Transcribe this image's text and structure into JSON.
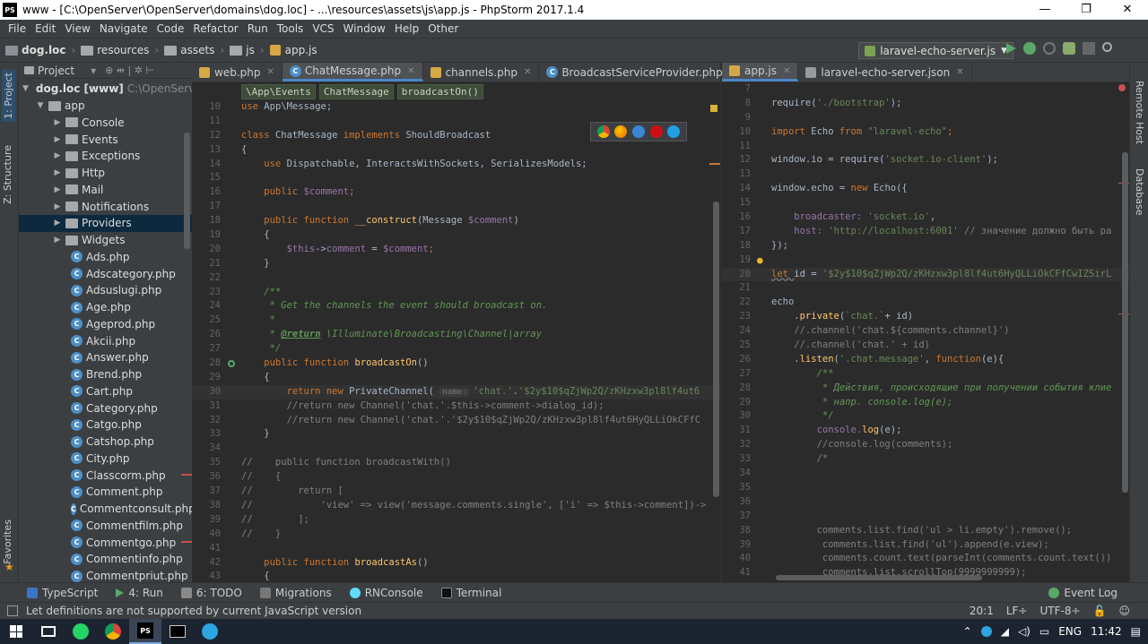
{
  "window": {
    "title": "www - [C:\\OpenServer\\OpenServer\\domains\\dog.loc] - ...\\resources\\assets\\js\\app.js - PhpStorm 2017.1.4",
    "logo_text": "PS",
    "minimize": "—",
    "maximize": "❐",
    "close": "✕"
  },
  "menu": [
    "File",
    "Edit",
    "View",
    "Navigate",
    "Code",
    "Refactor",
    "Run",
    "Tools",
    "VCS",
    "Window",
    "Help",
    "Other"
  ],
  "breadcrumbs": [
    "dog.loc",
    "resources",
    "assets",
    "js",
    "app.js"
  ],
  "run_config": {
    "label": "laravel-echo-server.js",
    "arrow": "▼"
  },
  "side_tabs": {
    "project": "1: Project",
    "structure": "Z: Structure",
    "favorites": "Favorites",
    "remote": "Remote Host",
    "database": "Database"
  },
  "project_panel": {
    "title": "Project",
    "dropdown": "▾",
    "tools": "⊕  ⇹  |  ✲  ⊢",
    "root": {
      "name": "dog.loc [www]",
      "path": "C:\\OpenServer"
    },
    "app": "app",
    "folders": [
      "Console",
      "Events",
      "Exceptions",
      "Http",
      "Mail",
      "Notifications",
      "Providers",
      "Widgets"
    ],
    "selected_folder": "Providers",
    "files": [
      "Ads.php",
      "Adscategory.php",
      "Adsuslugi.php",
      "Age.php",
      "Ageprod.php",
      "Akcii.php",
      "Answer.php",
      "Brend.php",
      "Cart.php",
      "Category.php",
      "Catgo.php",
      "Catshop.php",
      "City.php",
      "Classcorm.php",
      "Comment.php",
      "Commentconsult.php",
      "Commentfilm.php",
      "Commentgo.php",
      "Commentinfo.php",
      "Commentpriut.php"
    ]
  },
  "left_editor": {
    "tabs": [
      {
        "label": "web.php",
        "active": false
      },
      {
        "label": "ChatMessage.php",
        "active": true
      },
      {
        "label": "channels.php",
        "active": false
      },
      {
        "label": "BroadcastServiceProvider.php",
        "active": false
      }
    ],
    "breadcrumb": [
      "\\App\\Events",
      "ChatMessage",
      "broadcastOn()"
    ],
    "line_numbers": [
      "10",
      "11",
      "12",
      "13",
      "14",
      "15",
      "16",
      "17",
      "18",
      "19",
      "20",
      "21",
      "22",
      "23",
      "24",
      "25",
      "26",
      "27",
      "28",
      "29",
      "30",
      "31",
      "32",
      "33",
      "34",
      "35",
      "36",
      "37",
      "38",
      "39",
      "40",
      "41",
      "42",
      "43"
    ],
    "code": {
      "l10a": "use ",
      "l10b": "App\\Message;",
      "l12a": "class ",
      "l12b": "ChatMessage ",
      "l12c": "implements ",
      "l12d": "ShouldBroadcast",
      "l13": "{",
      "l14a": "    use ",
      "l14b": "Dispatchable, InteractsWithSockets, SerializesModels;",
      "l16a": "    public ",
      "l16b": "$comment",
      "l16c": ";",
      "l18a": "    public function ",
      "l18b": "__construct",
      "l18c": "(Message ",
      "l18d": "$comment",
      "l18e": ")",
      "l19": "    {",
      "l20a": "        ",
      "l20b": "$this",
      "l20c": "->",
      "l20d": "comment",
      "l20e": " = ",
      "l20f": "$comment",
      "l20g": ";",
      "l21": "    }",
      "l23": "    /**",
      "l24": "     * Get the channels the event should broadcast on.",
      "l25": "     *",
      "l26a": "     * ",
      "l26b": "@return",
      "l26c": " \\Illuminate\\Broadcasting\\Channel|array",
      "l27": "     */",
      "l28a": "    public function ",
      "l28b": "broadcastOn",
      "l28c": "()",
      "l29": "    {",
      "l30a": "        return new ",
      "l30b": "PrivateChannel( ",
      "l30hint": "name:",
      "l30c": "'chat.'",
      "l30d": ".",
      "l30e": "'$2y$10$qZjWp2Q/zKHzxw3pl8lf4ut6",
      "l31": "        //return new Channel('chat.'.$this->comment->dialog_id);",
      "l32": "        //return new Channel('chat.'.'$2y$10$qZjWp2Q/zKHzxw3pl8lf4ut6HyQLLiOkCFfC",
      "l33": "    }",
      "l35": "//    public function broadcastWith()",
      "l36": "//    {",
      "l37": "//        return [",
      "l38": "//            'view' => view('message.comments.single', ['i' => $this->comment])->",
      "l39": "//        ];",
      "l40": "//    }",
      "l42a": "    public function ",
      "l42b": "broadcastAs",
      "l42c": "()",
      "l43": "    {"
    }
  },
  "right_editor": {
    "tabs": [
      {
        "label": "app.js",
        "active": true
      },
      {
        "label": "laravel-echo-server.json",
        "active": false
      }
    ],
    "line_numbers": [
      "7",
      "8",
      "9",
      "10",
      "11",
      "12",
      "13",
      "14",
      "15",
      "16",
      "17",
      "18",
      "19",
      "20",
      "21",
      "22",
      "23",
      "24",
      "25",
      "26",
      "27",
      "28",
      "29",
      "30",
      "31",
      "32",
      "33",
      "34",
      "35",
      "36",
      "37",
      "38",
      "39",
      "40",
      "41"
    ],
    "code": {
      "l8a": "require(",
      "l8b": "'./bootstrap'",
      "l8c": ");",
      "l10a": "import ",
      "l10b": "Echo ",
      "l10c": "from ",
      "l10d": "\"laravel-echo\"",
      "l10e": ";",
      "l12a": "window.io = require(",
      "l12b": "'socket.io-client'",
      "l12c": ");",
      "l14a": "window.echo = ",
      "l14b": "new ",
      "l14c": "Echo({",
      "l16a": "    broadcaster: ",
      "l16b": "'socket.io'",
      "l16c": ",",
      "l17a": "    host: ",
      "l17b": "'http://localhost:6001'",
      "l17c": " // значение должно быть ра",
      "l18": "});",
      "l20a": "let ",
      "l20b": "id = ",
      "l20c": "'$2y$10$qZjWp2Q/zKHzxw3pl8lf4ut6HyQLLiOkCFfCwIZSirL",
      "l22": "echo",
      "l23a": "    .",
      "l23b": "private",
      "l23c": "(",
      "l23d": "`chat.`",
      "l23e": "+ id)",
      "l24": "    //.channel('chat.${comments.channel}')",
      "l25": "    //.channel('chat.' + id)",
      "l26a": "    .",
      "l26b": "listen",
      "l26c": "(",
      "l26d": "'.chat.message'",
      "l26e": ", ",
      "l26f": "function",
      "l26g": "(e){",
      "l27": "        /**",
      "l28": "         * Действия, происходящие при получении события клие",
      "l29": "         * напр. console.log(e);",
      "l30": "         */",
      "l31a": "        console.",
      "l31b": "log",
      "l31c": "(e);",
      "l32": "        //console.log(comments);",
      "l33": "        /*",
      "l38": "        comments.list.find('ul > li.empty').remove();",
      "l39": "         comments.list.find('ul').append(e.view);",
      "l40": "         comments.count.text(parseInt(comments.count.text())",
      "l41": "         comments.list.scrollTop(9999999999);"
    }
  },
  "bottom_tools": [
    "TypeScript",
    "4: Run",
    "6: TODO",
    "Migrations",
    "RNConsole",
    "Terminal"
  ],
  "event_log": "Event Log",
  "status": {
    "message": "Let definitions are not supported by current JavaScript version",
    "position": "20:1",
    "line_sep": "LF÷",
    "encoding": "UTF-8÷"
  },
  "taskbar": {
    "lang": "ENG",
    "time": "11:42"
  },
  "colors": {
    "accent": "#4a88c7",
    "selection": "#0d293e",
    "bg": "#2b2b2b",
    "panel": "#3c3f41"
  }
}
